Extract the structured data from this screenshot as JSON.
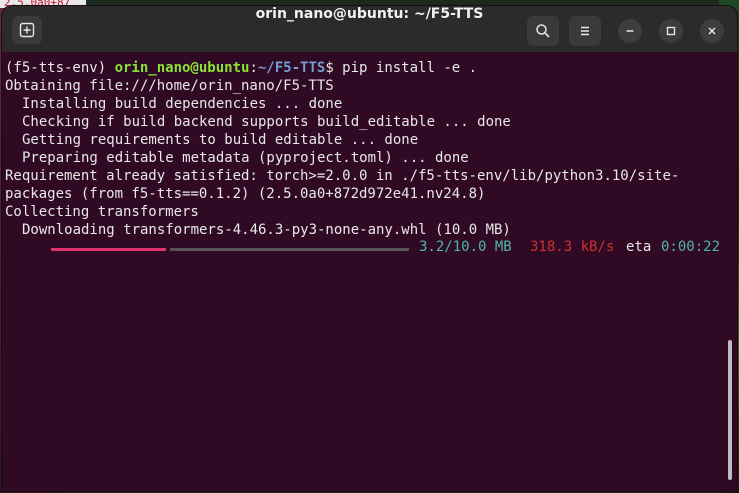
{
  "background": {
    "partial_tab_text": "2.5.0a0+87"
  },
  "window": {
    "title": "orin_nano@ubuntu: ~/F5-TTS",
    "colors": {
      "terminal_bg": "#300a24",
      "titlebar_bg": "#2b2b2b",
      "prompt_user": "#8ae234",
      "prompt_path": "#729fcf",
      "progress_fill": "#e0336b",
      "progress_size": "#4fb5a5",
      "progress_speed": "#cc3030"
    }
  },
  "icons": {
    "new_tab": "new-tab-icon",
    "search": "search-icon",
    "menu": "hamburger-menu-icon",
    "minimize": "minimize-icon",
    "maximize": "maximize-icon",
    "close": "close-icon"
  },
  "terminal": {
    "prompt": {
      "env": "(f5-tts-env) ",
      "user_host": "orin_nano@ubuntu",
      "separator": ":",
      "path": "~/F5-TTS",
      "symbol": "$",
      "command": " pip install -e ."
    },
    "lines": [
      "Obtaining file:///home/orin_nano/F5-TTS",
      "Installing build dependencies ... done",
      "Checking if build backend supports build_editable ... done",
      "Getting requirements to build editable ... done",
      "Preparing editable metadata (pyproject.toml) ... done",
      "Requirement already satisfied: torch>=2.0.0 in ./f5-tts-env/lib/python3.10/site-",
      "packages (from f5-tts==0.1.2) (2.5.0a0+872d972e41.nv24.8)",
      "Collecting transformers",
      "Downloading transformers-4.46.3-py3-none-any.whl (10.0 MB)"
    ],
    "progress": {
      "fraction": 0.32,
      "size": "3.2/10.0 MB",
      "speed": "318.3 kB/s",
      "eta_label": "eta",
      "eta": "0:00:22"
    }
  }
}
